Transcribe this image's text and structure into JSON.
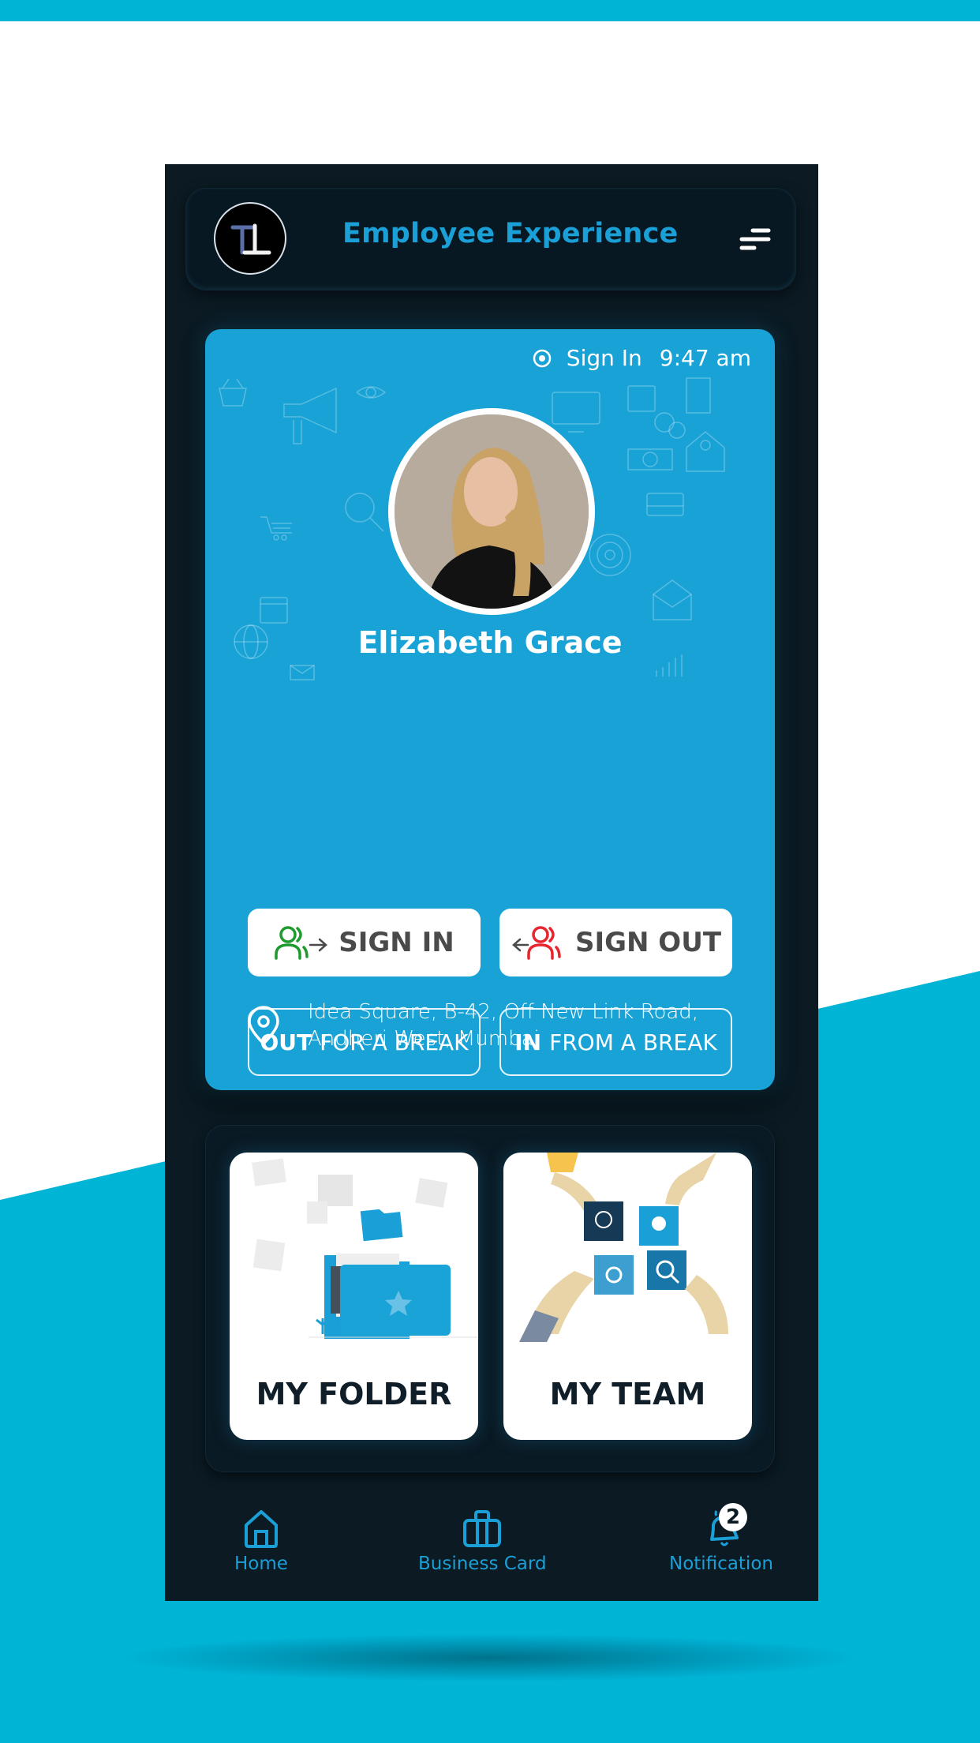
{
  "header": {
    "app_title": "Employee Experience",
    "logo_icon": "tl-monogram-logo",
    "menu_icon": "hamburger-menu-icon"
  },
  "profile": {
    "status_label": "Sign In",
    "status_time": "9:47 am",
    "name": "Elizabeth Grace",
    "address_line1": "Idea Square, B-42, Off New Link Road,",
    "address_line2": "Andheri West, Mumbai"
  },
  "actions": {
    "sign_in": "SIGN IN",
    "sign_out": "SIGN OUT",
    "out_break_bold": "OUT",
    "out_break_rest": "FOR A BREAK",
    "in_break_bold": "IN",
    "in_break_rest": "FROM A BREAK"
  },
  "tiles": [
    {
      "label": "MY FOLDER",
      "icon": "folder-illustration"
    },
    {
      "label": "MY TEAM",
      "icon": "puzzle-team-illustration"
    }
  ],
  "nav": {
    "items": [
      {
        "label": "Home",
        "icon": "home-icon"
      },
      {
        "label": "Business Card",
        "icon": "briefcase-icon"
      },
      {
        "label": "Notification",
        "icon": "bell-icon",
        "badge": "2"
      }
    ]
  },
  "colors": {
    "accent": "#1aa3d6",
    "background_band": "#00b4d6",
    "phone_bg": "#0b1a23",
    "sign_in_icon": "#1f9a2e",
    "sign_out_icon": "#e8242e"
  }
}
